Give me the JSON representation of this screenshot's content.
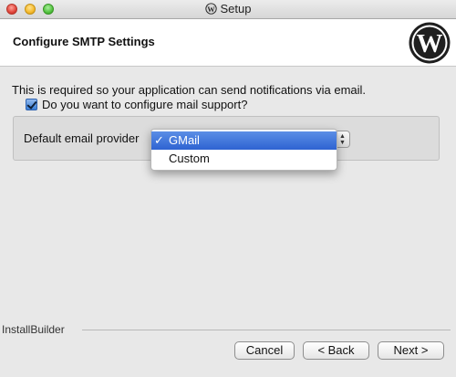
{
  "window": {
    "title": "Setup"
  },
  "header": {
    "title": "Configure SMTP Settings",
    "logo_icon": "wordpress-logo-icon"
  },
  "body": {
    "description": "This is required so your application can send notifications via email.",
    "checkbox": {
      "label": "Do you want to configure mail support?",
      "checked": true
    },
    "provider": {
      "label": "Default email provider",
      "selected": "GMail",
      "options": [
        "GMail",
        "Custom"
      ]
    }
  },
  "footer": {
    "brand": "InstallBuilder"
  },
  "buttons": {
    "cancel": "Cancel",
    "back": "< Back",
    "next": "Next >"
  },
  "colors": {
    "selection": "#2e63d2",
    "checkbox": "#3a7fd6"
  }
}
